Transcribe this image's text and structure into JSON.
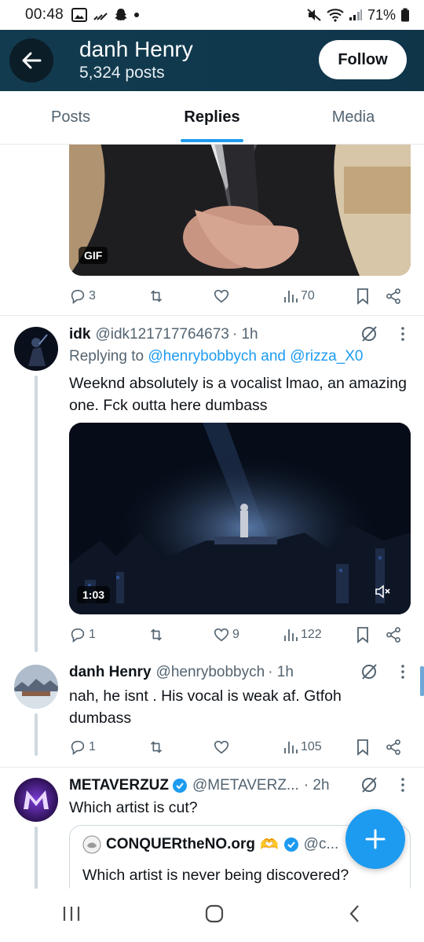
{
  "status_bar": {
    "time": "00:48",
    "battery": "71%"
  },
  "header": {
    "name": "danh Henry",
    "post_count": "5,324 posts",
    "follow_label": "Follow"
  },
  "tabs": [
    {
      "label": "Posts",
      "active": false
    },
    {
      "label": "Replies",
      "active": true
    },
    {
      "label": "Media",
      "active": false
    }
  ],
  "tweet0": {
    "media_badge": "GIF",
    "replies": "3",
    "retweets": "",
    "likes": "",
    "views": "70"
  },
  "tweet1": {
    "name": "idk",
    "handle": "@idk121717764673",
    "time": "· 1h",
    "replying_prefix": "Replying to",
    "replying_user1": "@henrybobbych",
    "replying_and": "and",
    "replying_user2": "@rizza_X0",
    "text": "Weeknd absolutely is a vocalist lmao, an amazing one. Fck outta here dumbass",
    "video_duration": "1:03",
    "replies": "1",
    "likes": "9",
    "views": "122"
  },
  "tweet2": {
    "name": "danh Henry",
    "handle": "@henrybobbych",
    "time": "· 1h",
    "text": "nah, he isnt . His vocal is weak af. Gtfoh dumbass",
    "replies": "1",
    "views": "105"
  },
  "tweet3": {
    "name": "METAVERZUZ",
    "handle": "@METAVERZ...",
    "time": "· 2h",
    "text": "Which artist is cut?",
    "quote_name": "CONQUERtheNO.org",
    "quote_emoji": "🫶",
    "quote_handle": "@c...",
    "quote_text": "Which artist is never being discovered?"
  },
  "colors": {
    "accent": "#1d9bf0",
    "header_bg": "#133b4f",
    "secondary_text": "#536471"
  },
  "icons": [
    "back-arrow-icon",
    "reply-icon",
    "retweet-icon",
    "like-icon",
    "views-icon",
    "bookmark-icon",
    "share-icon",
    "grok-icon",
    "more-icon",
    "mute-icon",
    "verified-icon",
    "compose-plus-icon",
    "recents-icon",
    "home-icon",
    "back-icon"
  ]
}
